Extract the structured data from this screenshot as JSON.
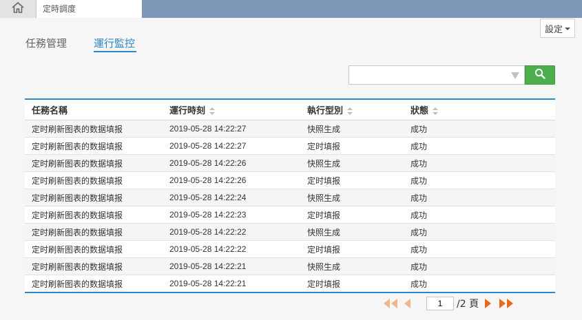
{
  "topbar": {
    "home_icon": "home-icon",
    "tab_title": "定時調度"
  },
  "settings": {
    "label": "設定",
    "caret_icon": "caret-down-icon"
  },
  "nav": {
    "tabs": [
      {
        "label": "任務管理"
      },
      {
        "label": "運行監控"
      }
    ],
    "active_index": 1
  },
  "search": {
    "value": "",
    "placeholder": "",
    "dropdown_icon": "dropdown-triangle-icon",
    "button_icon": "search-icon",
    "button_color": "#4cae4c"
  },
  "table": {
    "headers": [
      "任務名稱",
      "運行時刻",
      "執行型別",
      "狀態"
    ],
    "rows": [
      {
        "name": "定时刷新图表的数据填报",
        "time": "2019-05-28 14:22:27",
        "type": "快照生成",
        "status": "成功"
      },
      {
        "name": "定时刷新图表的数据填报",
        "time": "2019-05-28 14:22:27",
        "type": "定时填报",
        "status": "成功"
      },
      {
        "name": "定时刷新图表的数据填报",
        "time": "2019-05-28 14:22:26",
        "type": "快照生成",
        "status": "成功"
      },
      {
        "name": "定时刷新图表的数据填报",
        "time": "2019-05-28 14:22:26",
        "type": "定时填报",
        "status": "成功"
      },
      {
        "name": "定时刷新图表的数据填报",
        "time": "2019-05-28 14:22:24",
        "type": "快照生成",
        "status": "成功"
      },
      {
        "name": "定时刷新图表的数据填报",
        "time": "2019-05-28 14:22:23",
        "type": "定时填报",
        "status": "成功"
      },
      {
        "name": "定时刷新图表的数据填报",
        "time": "2019-05-28 14:22:22",
        "type": "快照生成",
        "status": "成功"
      },
      {
        "name": "定时刷新图表的数据填报",
        "time": "2019-05-28 14:22:22",
        "type": "定时填报",
        "status": "成功"
      },
      {
        "name": "定时刷新图表的数据填报",
        "time": "2019-05-28 14:22:21",
        "type": "快照生成",
        "status": "成功"
      },
      {
        "name": "定时刷新图表的数据填报",
        "time": "2019-05-28 14:22:21",
        "type": "定时填报",
        "status": "成功"
      }
    ]
  },
  "pagination": {
    "current_page": "1",
    "total_text": "/2 頁",
    "accent_color": "#e8691c",
    "disabled_color": "#f1b58e"
  },
  "colors": {
    "topbar": "#7f98b9",
    "accent": "#2b87c8"
  }
}
